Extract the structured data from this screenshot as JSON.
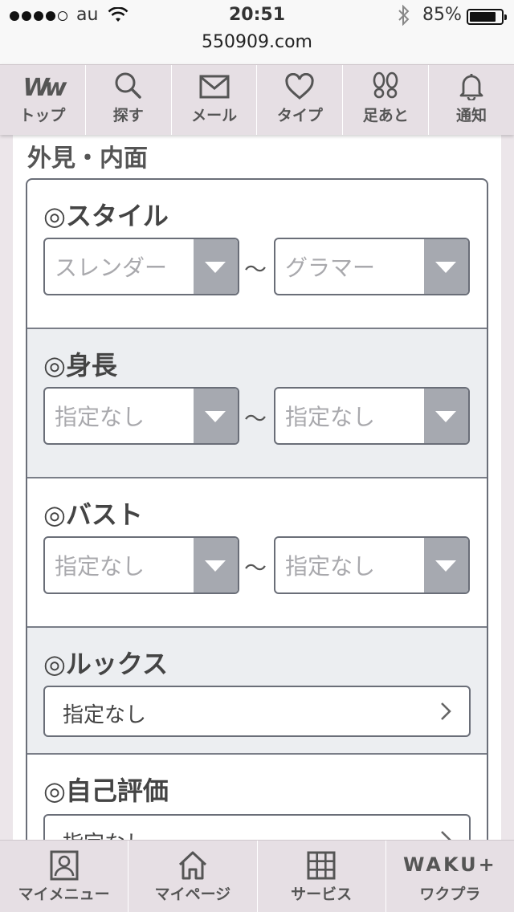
{
  "status": {
    "carrier": "au",
    "time": "20:51",
    "battery_text": "85%",
    "battery_level": 0.85,
    "url": "550909.com"
  },
  "top_nav": [
    {
      "label": "トップ",
      "icon": "ww-logo-icon",
      "logo_text": "Ww"
    },
    {
      "label": "探す",
      "icon": "search-icon"
    },
    {
      "label": "メール",
      "icon": "mail-icon"
    },
    {
      "label": "タイプ",
      "icon": "heart-icon"
    },
    {
      "label": "足あと",
      "icon": "footprints-icon"
    },
    {
      "label": "通知",
      "icon": "bell-icon"
    }
  ],
  "section_title": "外見・内面",
  "filters": {
    "style": {
      "title": "◎スタイル",
      "from": "スレンダー",
      "to": "グラマー",
      "sep": "〜"
    },
    "height": {
      "title": "◎身長",
      "from": "指定なし",
      "to": "指定なし",
      "sep": "〜"
    },
    "bust": {
      "title": "◎バスト",
      "from": "指定なし",
      "to": "指定なし",
      "sep": "〜"
    },
    "looks": {
      "title": "◎ルックス",
      "value": "指定なし"
    },
    "self_rating": {
      "title": "◎自己評価",
      "value": "指定なし"
    }
  },
  "bottom_nav": [
    {
      "label": "マイメニュー",
      "icon": "user-card-icon"
    },
    {
      "label": "マイページ",
      "icon": "home-icon"
    },
    {
      "label": "サービス",
      "icon": "grid-icon"
    },
    {
      "label": "ワクプラ",
      "icon": "waku-logo-icon",
      "logo_text": "WAKU+"
    }
  ],
  "colors": {
    "nav_bg": "#e6dfe4",
    "border": "#6a6e78",
    "select_arrow_bg": "#a6a9b0",
    "alt_block_bg": "#eceef1"
  }
}
